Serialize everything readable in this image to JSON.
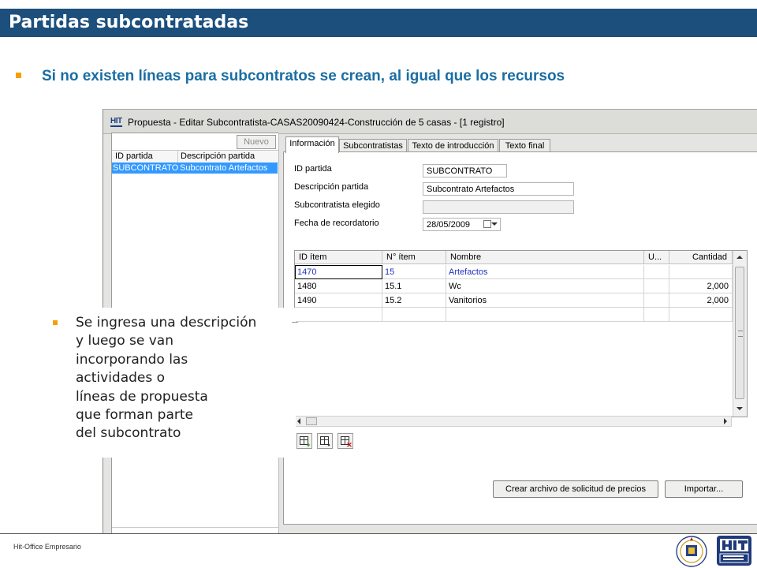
{
  "slide": {
    "title": "Partidas subcontratadas",
    "bullet": "Si no existen líneas para subcontratos se crean, al igual que los recursos",
    "callout": "Se ingresa una descripción\ny luego se van\nincorporando las\nactividades o\nlíneas de propuesta\nque forman parte\ndel subcontrato",
    "footer": "Hit-Office Empresario"
  },
  "window": {
    "logo_text": "HIT",
    "title": "Propuesta - Editar Subcontratista-CASAS20090424-Construcción de 5 casas - [1 registro]"
  },
  "left_pane": {
    "nuevo_label": "Nuevo",
    "columns": [
      "ID partida",
      "Descripción partida"
    ],
    "rows": [
      {
        "id": "SUBCONTRATO",
        "descripcion": "Subcontrato Artefactos"
      }
    ]
  },
  "tabs": [
    {
      "label": "Información",
      "active": true
    },
    {
      "label": "Subcontratistas",
      "active": false
    },
    {
      "label": "Texto de introducción",
      "active": false
    },
    {
      "label": "Texto final",
      "active": false
    }
  ],
  "form": {
    "id_partida_label": "ID partida",
    "id_partida_value": "SUBCONTRATO",
    "descripcion_label": "Descripción partida",
    "descripcion_value": "Subcontrato Artefactos",
    "subcontratista_label": "Subcontratista elegido",
    "subcontratista_value": "",
    "fecha_label": "Fecha de recordatorio",
    "fecha_value": "28/05/2009"
  },
  "grid": {
    "columns": [
      "ID ítem",
      "N° ítem",
      "Nombre",
      "U...",
      "Cantidad"
    ],
    "rows": [
      {
        "id": "1470",
        "num": "15",
        "nombre": "Artefactos",
        "u": "",
        "cantidad": ""
      },
      {
        "id": "1480",
        "num": "15.1",
        "nombre": "Wc",
        "u": "",
        "cantidad": "2,000"
      },
      {
        "id": "1490",
        "num": "15.2",
        "nombre": "Vanitorios",
        "u": "",
        "cantidad": "2,000"
      }
    ]
  },
  "toolbar_icons": [
    "add-row-icon",
    "edit-row-icon",
    "delete-row-icon"
  ],
  "buttons": {
    "crear": "Crear archivo de solicitud de precios",
    "importar": "Importar..."
  },
  "colors": {
    "title_bar": "#1c4f7c",
    "bullet": "#f5a000",
    "bullet_text": "#1a6ea3",
    "selection": "#3399ff"
  }
}
